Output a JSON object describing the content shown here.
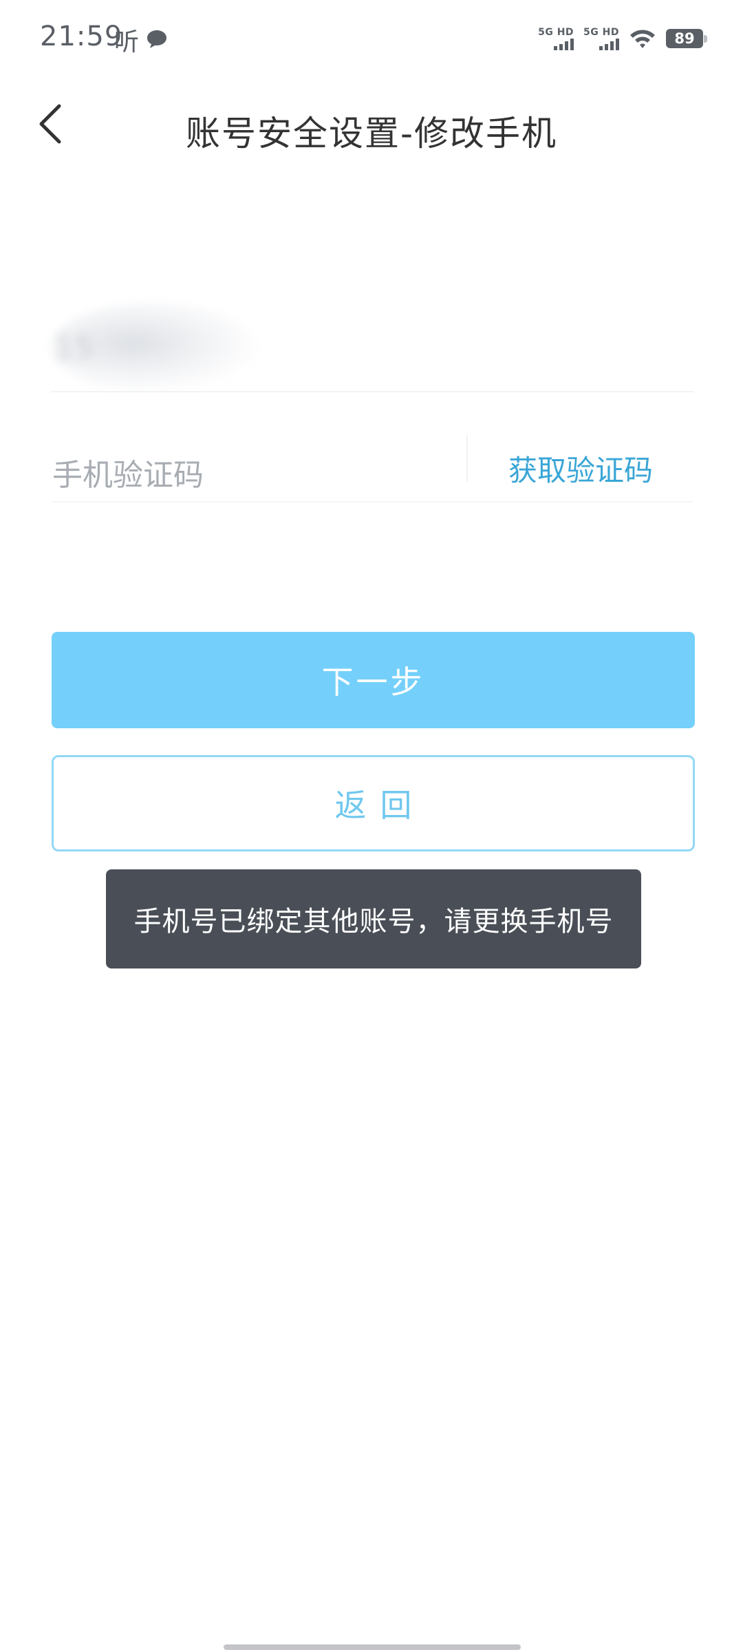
{
  "status_bar": {
    "time": "21:59",
    "app_indicator": "听",
    "signal_1_label": "5G HD",
    "signal_2_label": "5G HD",
    "battery": "89",
    "icons": [
      "chat-bubble-icon",
      "signal-icon",
      "signal-icon",
      "wifi-icon",
      "battery-icon"
    ]
  },
  "nav": {
    "title": "账号安全设置-修改手机",
    "back_icon": "chevron-left-icon"
  },
  "form": {
    "phone_value": "15",
    "code_placeholder": "手机验证码",
    "get_code_label": "获取验证码"
  },
  "buttons": {
    "next_label": "下一步",
    "back_label": "返回"
  },
  "toast": {
    "message": "手机号已绑定其他账号，请更换手机号"
  },
  "colors": {
    "primary": "#74d0fb",
    "link": "#3aa6d6",
    "outline": "#92d8f5",
    "toast_bg": "#4a4f57"
  }
}
